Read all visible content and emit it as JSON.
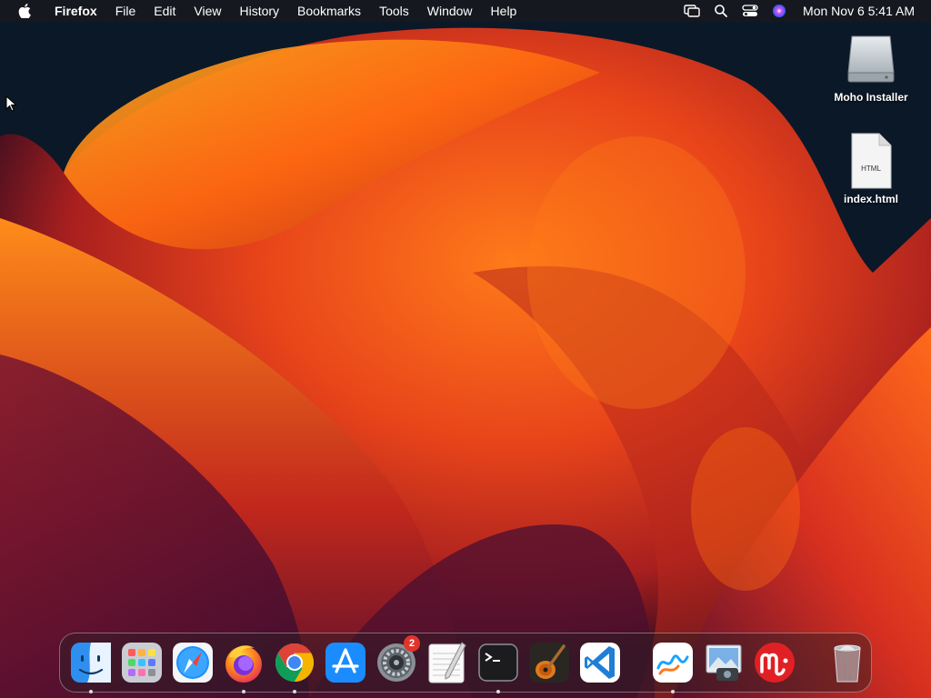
{
  "menubar": {
    "app_name": "Firefox",
    "menus": [
      "File",
      "Edit",
      "View",
      "History",
      "Bookmarks",
      "Tools",
      "Window",
      "Help"
    ],
    "status_icons": [
      "screen-mirroring-icon",
      "spotlight-search-icon",
      "control-center-icon",
      "siri-icon"
    ],
    "clock": "Mon Nov 6  5:41 AM"
  },
  "desktop": {
    "items": [
      {
        "label": "Moho Installer",
        "icon": "disk-image-icon"
      },
      {
        "label": "index.html",
        "icon": "html-file-icon",
        "badge": "HTML"
      }
    ]
  },
  "dock": {
    "apps": [
      {
        "name": "Finder",
        "icon": "finder-icon",
        "running": true
      },
      {
        "name": "Launchpad",
        "icon": "launchpad-icon",
        "running": false
      },
      {
        "name": "Safari",
        "icon": "safari-icon",
        "running": false
      },
      {
        "name": "Firefox",
        "icon": "firefox-icon",
        "running": true
      },
      {
        "name": "Google Chrome",
        "icon": "chrome-icon",
        "running": true
      },
      {
        "name": "App Store",
        "icon": "app-store-icon",
        "running": false
      },
      {
        "name": "System Settings",
        "icon": "system-settings-icon",
        "running": false,
        "badge": "2"
      },
      {
        "name": "TextEdit",
        "icon": "textedit-icon",
        "running": false
      },
      {
        "name": "Terminal",
        "icon": "terminal-icon",
        "running": true
      },
      {
        "name": "GarageBand",
        "icon": "garageband-icon",
        "running": false
      },
      {
        "name": "Visual Studio Code",
        "icon": "vscode-icon",
        "running": false
      }
    ],
    "recent": [
      {
        "name": "Freeform",
        "icon": "freeform-icon",
        "running": true
      },
      {
        "name": "Preview",
        "icon": "preview-icon",
        "running": false
      },
      {
        "name": "Moho",
        "icon": "moho-icon",
        "running": false
      }
    ],
    "trash": {
      "name": "Trash",
      "icon": "trash-icon"
    }
  }
}
